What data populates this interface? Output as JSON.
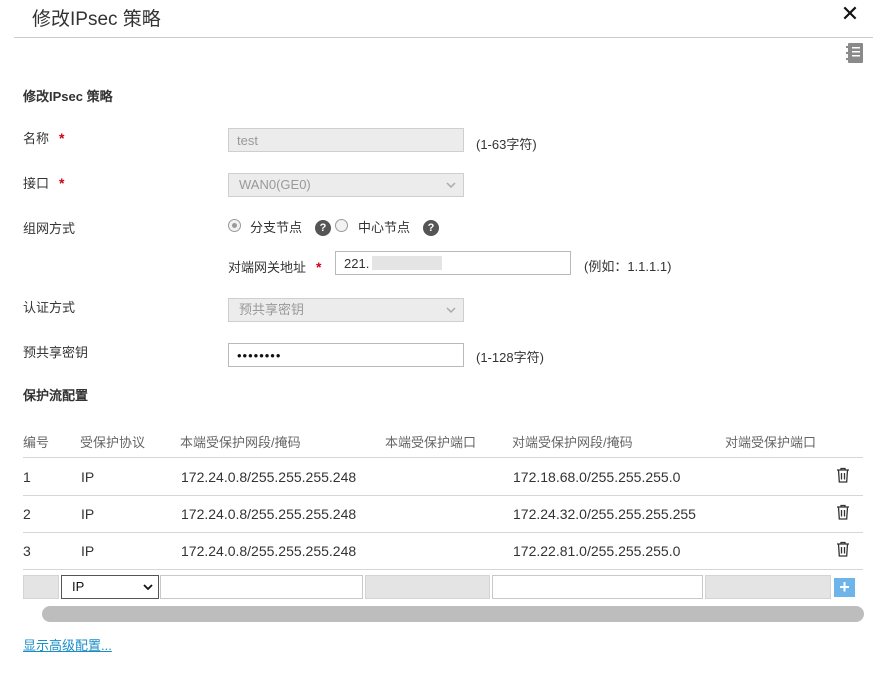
{
  "dialog": {
    "title": "修改IPsec 策略",
    "close_label": "✕"
  },
  "form": {
    "section_title": "修改IPsec 策略",
    "name": {
      "label": "名称",
      "required": "*",
      "value": "test",
      "hint": "(1-63字符)"
    },
    "interface": {
      "label": "接口",
      "required": "*",
      "value": "WAN0(GE0)"
    },
    "network_mode": {
      "label": "组网方式",
      "options": [
        {
          "label": "分支节点",
          "selected": true
        },
        {
          "label": "中心节点",
          "selected": false
        }
      ],
      "help": "?"
    },
    "peer_gateway": {
      "label": "对端网关地址",
      "required": "*",
      "value": "221.",
      "hint": "(例如：1.1.1.1)"
    },
    "auth_method": {
      "label": "认证方式",
      "value": "预共享密钥"
    },
    "psk": {
      "label": "预共享密钥",
      "value": "••••••••",
      "hint": "(1-128字符)"
    }
  },
  "protect_flow": {
    "section_title": "保护流配置",
    "headers": [
      "编号",
      "受保护协议",
      "本端受保护网段/掩码",
      "本端受保护端口",
      "对端受保护网段/掩码",
      "对端受保护端口"
    ],
    "rows": [
      {
        "id": "1",
        "protocol": "IP",
        "local_net": "172.24.0.8/255.255.255.248",
        "local_port": "",
        "remote_net": "172.18.68.0/255.255.255.0",
        "remote_port": ""
      },
      {
        "id": "2",
        "protocol": "IP",
        "local_net": "172.24.0.8/255.255.255.248",
        "local_port": "",
        "remote_net": "172.24.32.0/255.255.255.255",
        "remote_port": ""
      },
      {
        "id": "3",
        "protocol": "IP",
        "local_net": "172.24.0.8/255.255.255.248",
        "local_port": "",
        "remote_net": "172.22.81.0/255.255.255.0",
        "remote_port": ""
      }
    ],
    "new_row": {
      "protocol": "IP",
      "add_label": "+"
    }
  },
  "advanced_link": "显示高级配置...",
  "icons": {
    "close": "close-icon",
    "doc": "notebook-icon",
    "help": "question-icon",
    "delete": "trash-icon",
    "add": "plus-icon"
  },
  "colors": {
    "required": "#d0021b",
    "link": "#1a8ec7",
    "add_button": "#6cb4ea"
  }
}
